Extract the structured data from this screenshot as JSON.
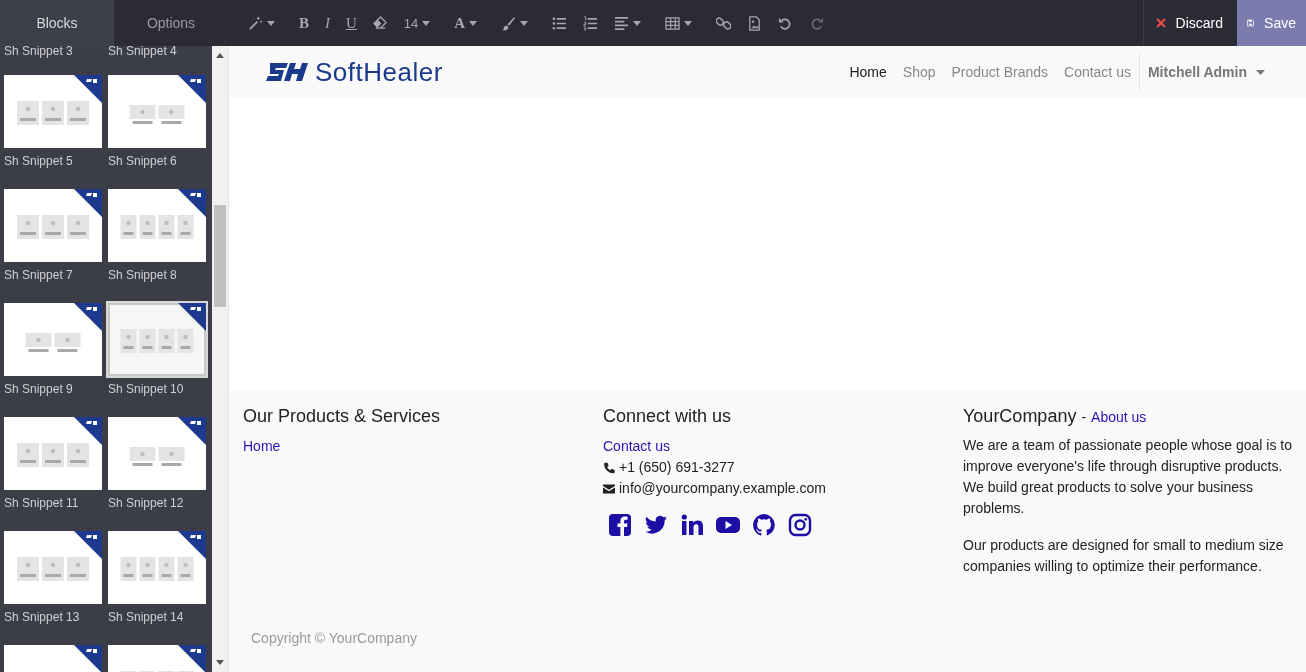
{
  "editor_tabs": [
    {
      "label": "Blocks",
      "selected": true
    },
    {
      "label": "Options",
      "selected": false
    }
  ],
  "snippets": [
    {
      "kind": "label-only",
      "label": "Sh Snippet 3"
    },
    {
      "kind": "label-only",
      "label": "Sh Snippet 4"
    },
    {
      "kind": "card",
      "label": "Sh Snippet 5",
      "hovered": false
    },
    {
      "kind": "card",
      "label": "Sh Snippet 6",
      "hovered": false
    },
    {
      "kind": "card",
      "label": "Sh Snippet 7",
      "hovered": false
    },
    {
      "kind": "card",
      "label": "Sh Snippet 8",
      "hovered": false
    },
    {
      "kind": "card",
      "label": "Sh Snippet 9",
      "hovered": false
    },
    {
      "kind": "card",
      "label": "Sh Snippet 10",
      "hovered": true
    },
    {
      "kind": "card",
      "label": "Sh Snippet 11",
      "hovered": false
    },
    {
      "kind": "card",
      "label": "Sh Snippet 12",
      "hovered": false
    },
    {
      "kind": "card",
      "label": "Sh Snippet 13",
      "hovered": false
    },
    {
      "kind": "card",
      "label": "Sh Snippet 14",
      "hovered": false
    },
    {
      "kind": "thumb-only"
    },
    {
      "kind": "thumb-only"
    }
  ],
  "toolbar": {
    "tools": [
      {
        "kind": "wand",
        "dropdown": true
      },
      {
        "kind": "bold",
        "label": "B"
      },
      {
        "kind": "italic",
        "label": "I"
      },
      {
        "kind": "underline",
        "label": "U"
      },
      {
        "kind": "eraser"
      },
      {
        "kind": "size",
        "label": "14",
        "dropdown": true
      },
      {
        "kind": "font-color",
        "label": "A",
        "dropdown": true
      },
      {
        "kind": "brush",
        "dropdown": true
      },
      {
        "kind": "bullets"
      },
      {
        "kind": "numbers"
      },
      {
        "kind": "align",
        "dropdown": true
      },
      {
        "kind": "table",
        "dropdown": true
      },
      {
        "kind": "link"
      },
      {
        "kind": "image"
      },
      {
        "kind": "undo"
      },
      {
        "kind": "redo",
        "disabled": true
      }
    ],
    "discard": "Discard",
    "save": "Save"
  },
  "site": {
    "brand": "SoftHealer",
    "nav": [
      {
        "label": "Home",
        "selected": true
      },
      {
        "label": "Shop",
        "selected": false
      },
      {
        "label": "Product Brands",
        "selected": false
      },
      {
        "label": "Contact us",
        "selected": false
      }
    ],
    "user": "Mitchell Admin"
  },
  "footer": {
    "products": {
      "heading": "Our Products & Services",
      "links": [
        "Home"
      ]
    },
    "connect": {
      "heading": "Connect with us",
      "contact_link": "Contact us",
      "phone": "+1 (650) 691-3277",
      "email": "info@yourcompany.example.com",
      "socials": [
        {
          "kind": "facebook"
        },
        {
          "kind": "twitter"
        },
        {
          "kind": "linkedin"
        },
        {
          "kind": "youtube"
        },
        {
          "kind": "github"
        },
        {
          "kind": "instagram"
        }
      ]
    },
    "about": {
      "company": "YourCompany",
      "dash": "-",
      "link": "About us",
      "paragraphs": [
        "We are a team of passionate people whose goal is to improve everyone's life through disruptive products. We build great products to solve your business problems.",
        "Our products are designed for small to medium size companies willing to optimize their performance."
      ]
    },
    "copyright": "Copyright © YourCompany"
  }
}
